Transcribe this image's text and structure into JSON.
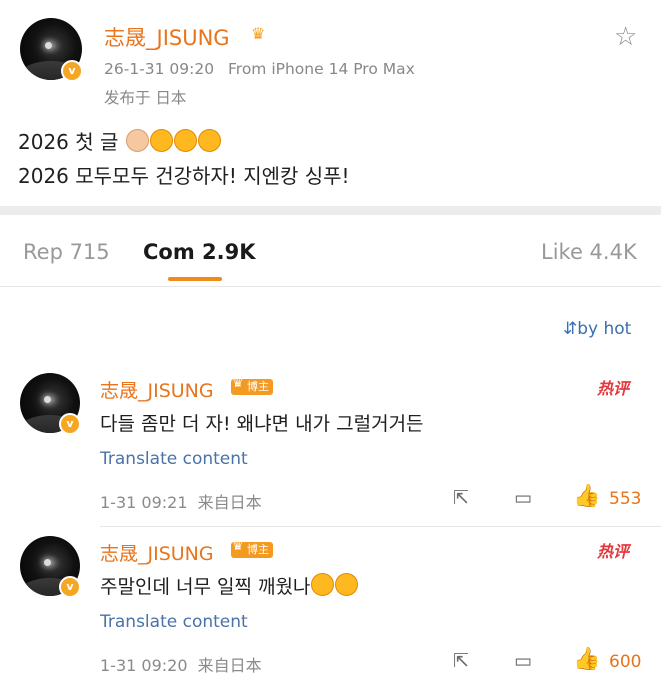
{
  "post": {
    "author": "志晟_JISUNG",
    "timestamp": "26-1-31 09:20",
    "source": "From iPhone 14 Pro Max",
    "location": "发布于 日本",
    "line1": "2026 첫 글",
    "line2": "2026 모두모두 건강하자! 지엔캉 싱푸!",
    "verified": "v"
  },
  "tabs": {
    "reposts": "Rep 715",
    "comments": "Com 2.9K",
    "likes": "Like 4.4K"
  },
  "sort_label": "by hot",
  "comments": [
    {
      "author": "志晟_JISUNG",
      "tag": "博主",
      "hot_label": "热评",
      "text": "다들 좀만 더 자! 왜냐면 내가 그럴거거든",
      "translate": "Translate content",
      "time": "1-31 09:21  来自日本",
      "likes": "553"
    },
    {
      "author": "志晟_JISUNG",
      "tag": "博主",
      "hot_label": "热评",
      "text": "주말인데 너무 일찍 깨웠나",
      "translate": "Translate content",
      "time": "1-31 09:20  来自日本",
      "likes": "600"
    }
  ],
  "icons": {
    "crown": "crown-icon",
    "star": "star-icon",
    "share": "share-icon",
    "comment": "comment-icon",
    "like": "thumbs-up-icon",
    "sort": "sort-icon"
  },
  "colors": {
    "accent": "#e8741c",
    "link": "#4a72a8",
    "hot": "#e4393c"
  }
}
